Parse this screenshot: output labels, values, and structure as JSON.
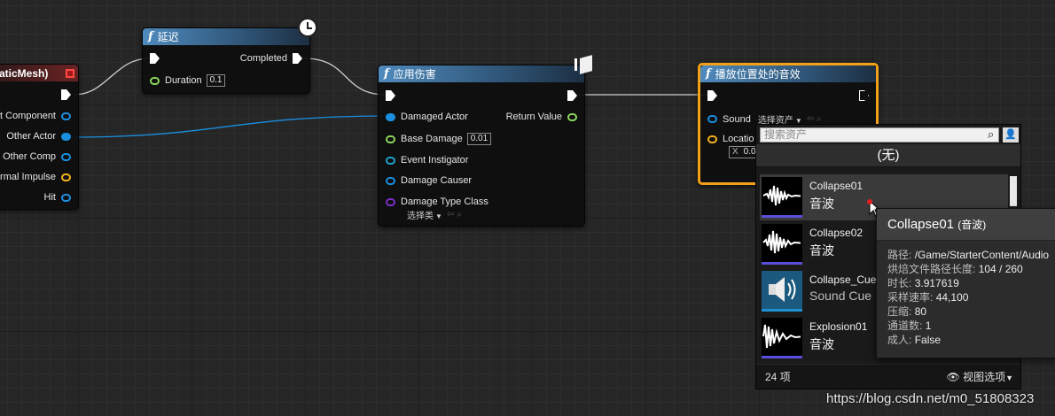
{
  "node_static_mesh": {
    "title": "StaticMesh)",
    "pins": [
      "it Component",
      "Other Actor",
      "Other Comp",
      "rmal Impulse",
      "Hit"
    ]
  },
  "node_delay": {
    "title": "延迟",
    "completed": "Completed",
    "duration_label": "Duration",
    "duration_value": "0.1"
  },
  "node_apply_damage": {
    "title": "应用伤害",
    "damaged_actor": "Damaged Actor",
    "return_value": "Return Value",
    "base_damage": "Base Damage",
    "base_damage_value": "0.01",
    "event_instigator": "Event Instigator",
    "damage_causer": "Damage Causer",
    "damage_type_class": "Damage Type Class",
    "damage_type_select": "选择类"
  },
  "node_play_sound": {
    "title": "播放位置处的音效",
    "sound_label": "Sound",
    "sound_select": "选择资产",
    "location_label": "Locatio",
    "location_x_label": "X",
    "location_x_value": "0.0"
  },
  "asset_picker": {
    "search_placeholder": "搜索资产",
    "none_label": "(无)",
    "assets": [
      {
        "name": "Collapse01",
        "type": "音波"
      },
      {
        "name": "Collapse02",
        "type": "音波"
      },
      {
        "name": "Collapse_Cue",
        "type": "Sound Cue"
      },
      {
        "name": "Explosion01",
        "type": "音波"
      }
    ],
    "item_count": "24 项",
    "view_options": "视图选项"
  },
  "tooltip": {
    "title": "Collapse01",
    "title_type": "(音波)",
    "path_label": "路径:",
    "path_value": "/Game/StarterContent/Audio",
    "bake_label": "烘焙文件路径长度:",
    "bake_value": "104 / 260",
    "duration_label": "时长:",
    "duration_value": "3.917619",
    "sample_rate_label": "采样速率:",
    "sample_rate_value": "44,100",
    "compression_label": "压缩:",
    "compression_value": "80",
    "channels_label": "通道数:",
    "channels_value": "1",
    "mature_label": "成人:",
    "mature_value": "False"
  },
  "watermark": "https://blog.csdn.net/m0_51808323",
  "colors": {
    "object_pin": "#1a8fe0",
    "float_pin": "#8cd65c",
    "class_pin": "#7a2fc8",
    "vector_pin": "#f2b21a",
    "selected_outline": "#f2a01a",
    "function_header": "#4f8bbd"
  }
}
